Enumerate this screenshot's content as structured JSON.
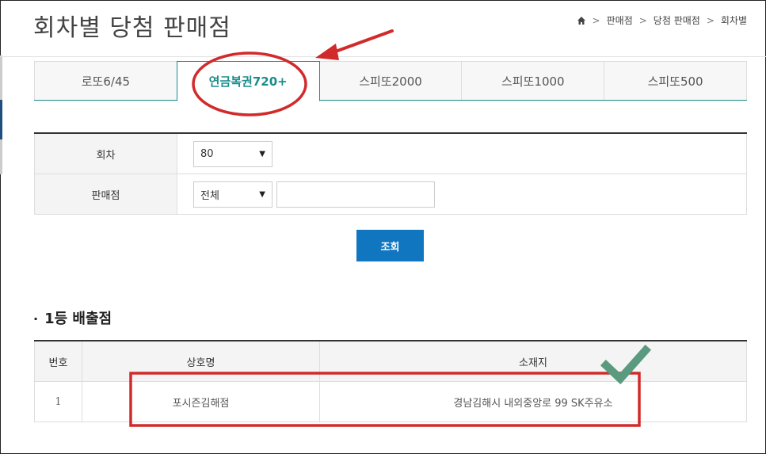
{
  "page": {
    "title": "회차별 당첨 판매점"
  },
  "breadcrumb": {
    "home_icon": "home-icon",
    "items": [
      "판매점",
      "당첨 판매점",
      "회차별"
    ],
    "separator": ">"
  },
  "tabs": [
    {
      "label": "로또6/45",
      "active": false
    },
    {
      "label": "연금복권720+",
      "active": true
    },
    {
      "label": "스피또2000",
      "active": false
    },
    {
      "label": "스피또1000",
      "active": false
    },
    {
      "label": "스피또500",
      "active": false
    }
  ],
  "form": {
    "round_label": "회차",
    "round_value": "80",
    "store_label": "판매점",
    "store_value": "전체",
    "store_search_value": "",
    "search_button": "조회"
  },
  "results": {
    "section_title": "1등 배출점",
    "columns": [
      "번호",
      "상호명",
      "소재지"
    ],
    "rows": [
      {
        "no": "1",
        "name": "포시즌김해점",
        "address": "경남김해시 내외중앙로 99 SK주유소"
      }
    ]
  },
  "annotations": {
    "circle_color": "#d22a2a",
    "arrow_color": "#d22a2a",
    "box_color": "#d22a2a",
    "check_color": "#5a9a7e",
    "icons": [
      "arrow-icon",
      "checkmark-icon"
    ]
  },
  "colors": {
    "accent_teal": "#1b8c8c",
    "button_blue": "#1176c0"
  }
}
